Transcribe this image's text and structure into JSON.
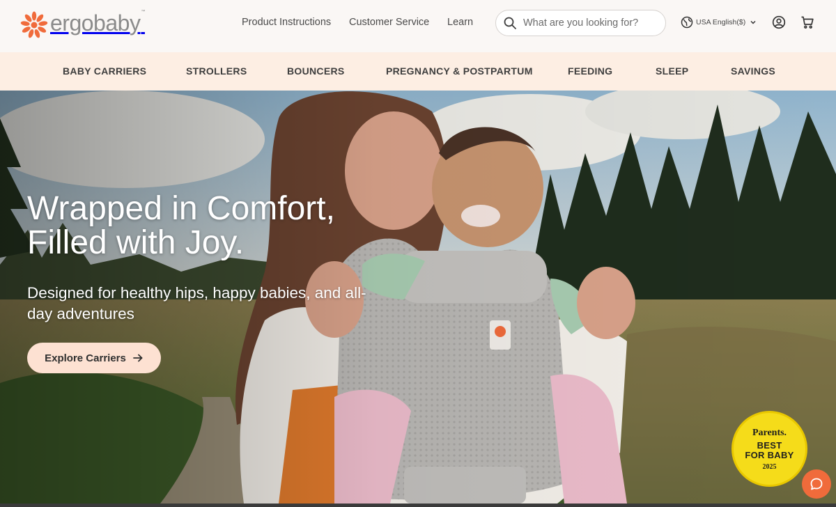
{
  "brand": {
    "name": "ergobaby",
    "trademark": "™",
    "accent_color": "#f06b3b"
  },
  "topnav": {
    "links": [
      {
        "label": "Product Instructions"
      },
      {
        "label": "Customer Service"
      },
      {
        "label": "Learn"
      }
    ],
    "search": {
      "placeholder": "What are you looking for?",
      "value": "",
      "icon": "search-icon"
    },
    "locale": {
      "label": "USA English($)",
      "icon": "globe-icon"
    },
    "account_icon": "user-circle-icon",
    "cart_icon": "cart-icon"
  },
  "category_nav": {
    "background": "#fdeee3",
    "items": [
      {
        "label": "BABY CARRIERS"
      },
      {
        "label": "STROLLERS"
      },
      {
        "label": "BOUNCERS"
      },
      {
        "label": "PREGNANCY & POSTPARTUM"
      },
      {
        "label": "FEEDING"
      },
      {
        "label": "SLEEP"
      },
      {
        "label": "SAVINGS"
      }
    ]
  },
  "hero": {
    "title_line1": "Wrapped in Comfort,",
    "title_line2": "Filled with Joy.",
    "subtitle": "Designed for healthy hips, happy babies, and all-day adventures",
    "cta_label": "Explore Carriers",
    "cta_color": "#fde1d2",
    "image_icon": "mother-with-baby-carrier-photo"
  },
  "award_badge": {
    "publisher": "Parents.",
    "line1": "BEST",
    "line2": "FOR BABY",
    "year": "2025",
    "color": "#f5dc1a"
  },
  "chat": {
    "icon": "chat-bubble-icon"
  }
}
